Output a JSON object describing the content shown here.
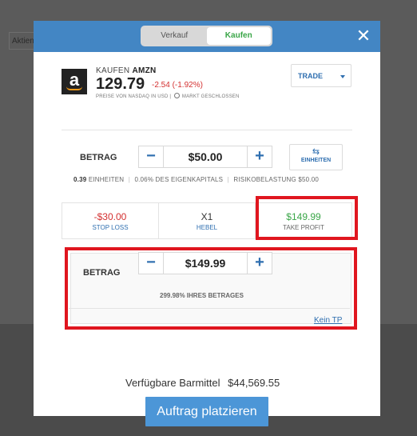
{
  "background": {
    "tab_label": "Aktien"
  },
  "header": {
    "toggle": {
      "sell_label": "Verkauf",
      "buy_label": "Kaufen",
      "active": "buy"
    },
    "close_icon": "close-icon"
  },
  "instrument": {
    "action": "KAUFEN",
    "symbol": "AMZN",
    "price": "129.79",
    "change": "-2.54 (-1.92%)",
    "price_source": "PREISE VON NASDAQ IN USD",
    "market_status": "MARKT GESCHLOSSEN",
    "logo_icon": "amazon-logo-icon"
  },
  "trade_dropdown": {
    "label": "TRADE"
  },
  "amount": {
    "label": "BETRAG",
    "value": "$50.00",
    "units_button": "EINHEITEN",
    "units_icon": "swap-arrows-icon",
    "units": "0.39",
    "units_label": "EINHEITEN",
    "equity_pct": "0.06% DES EIGENKAPITALS",
    "risk": "RISIKOBELASTUNG $50.00"
  },
  "order_settings": {
    "stop_loss": {
      "value": "-$30.00",
      "label": "STOP LOSS"
    },
    "leverage": {
      "value": "X1",
      "label": "HEBEL"
    },
    "take_profit": {
      "value": "$149.99",
      "label": "TAKE PROFIT"
    }
  },
  "take_profit_panel": {
    "label": "BETRAG",
    "value": "$149.99",
    "percent_text": "299.98% IHRES BETRAGES",
    "no_tp_link": "Kein TP"
  },
  "footer": {
    "available_label": "Verfügbare Barmittel",
    "available_amount": "$44,569.55",
    "place_order_button": "Auftrag platzieren"
  },
  "colors": {
    "accent": "#4386c4",
    "buy": "#3aa648",
    "loss": "#d32f2f",
    "highlight": "#e0161f"
  }
}
